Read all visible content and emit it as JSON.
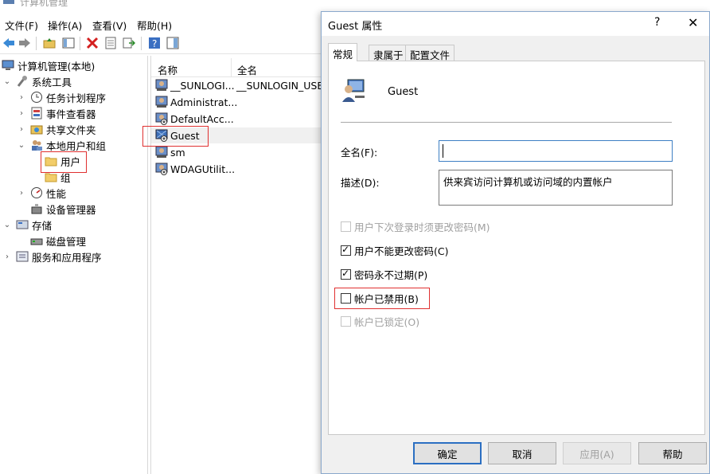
{
  "mmc": {
    "title": "计算机管理",
    "menu": [
      "文件(F)",
      "操作(A)",
      "查看(V)",
      "帮助(H)"
    ],
    "tree": [
      {
        "label": "计算机管理(本地)"
      },
      {
        "label": "系统工具"
      },
      {
        "label": "任务计划程序"
      },
      {
        "label": "事件查看器"
      },
      {
        "label": "共享文件夹"
      },
      {
        "label": "本地用户和组"
      },
      {
        "label": "用户"
      },
      {
        "label": "组"
      },
      {
        "label": "性能"
      },
      {
        "label": "设备管理器"
      },
      {
        "label": "存储"
      },
      {
        "label": "磁盘管理"
      },
      {
        "label": "服务和应用程序"
      }
    ],
    "list_headers": [
      "名称",
      "全名"
    ],
    "list_rows": [
      {
        "name": "__SUNLOGI...",
        "fullname": "__SUNLOGIN_USER"
      },
      {
        "name": "Administrat...",
        "fullname": ""
      },
      {
        "name": "DefaultAcc...",
        "fullname": ""
      },
      {
        "name": "Guest",
        "fullname": ""
      },
      {
        "name": "sm",
        "fullname": ""
      },
      {
        "name": "WDAGUtilit...",
        "fullname": ""
      }
    ]
  },
  "dialog": {
    "title": "Guest 属性",
    "help_glyph": "?",
    "close_glyph": "✕",
    "tabs": [
      "常规",
      "隶属于",
      "配置文件"
    ],
    "user_name": "Guest",
    "fullname_label": "全名(F):",
    "fullname_value": "",
    "desc_label": "描述(D):",
    "desc_value": "供来宾访问计算机或访问域的内置帐户",
    "checkboxes": [
      {
        "label": "用户下次登录时须更改密码(M)",
        "checked": false,
        "disabled": true
      },
      {
        "label": "用户不能更改密码(C)",
        "checked": true,
        "disabled": false
      },
      {
        "label": "密码永不过期(P)",
        "checked": true,
        "disabled": false
      },
      {
        "label": "帐户已禁用(B)",
        "checked": false,
        "disabled": false
      },
      {
        "label": "帐户已锁定(O)",
        "checked": false,
        "disabled": true
      }
    ],
    "buttons": {
      "ok": "确定",
      "cancel": "取消",
      "apply": "应用(A)",
      "help": "帮助"
    }
  },
  "colors": {
    "highlight_box": "#e03030",
    "accent": "#2b6fc2"
  }
}
